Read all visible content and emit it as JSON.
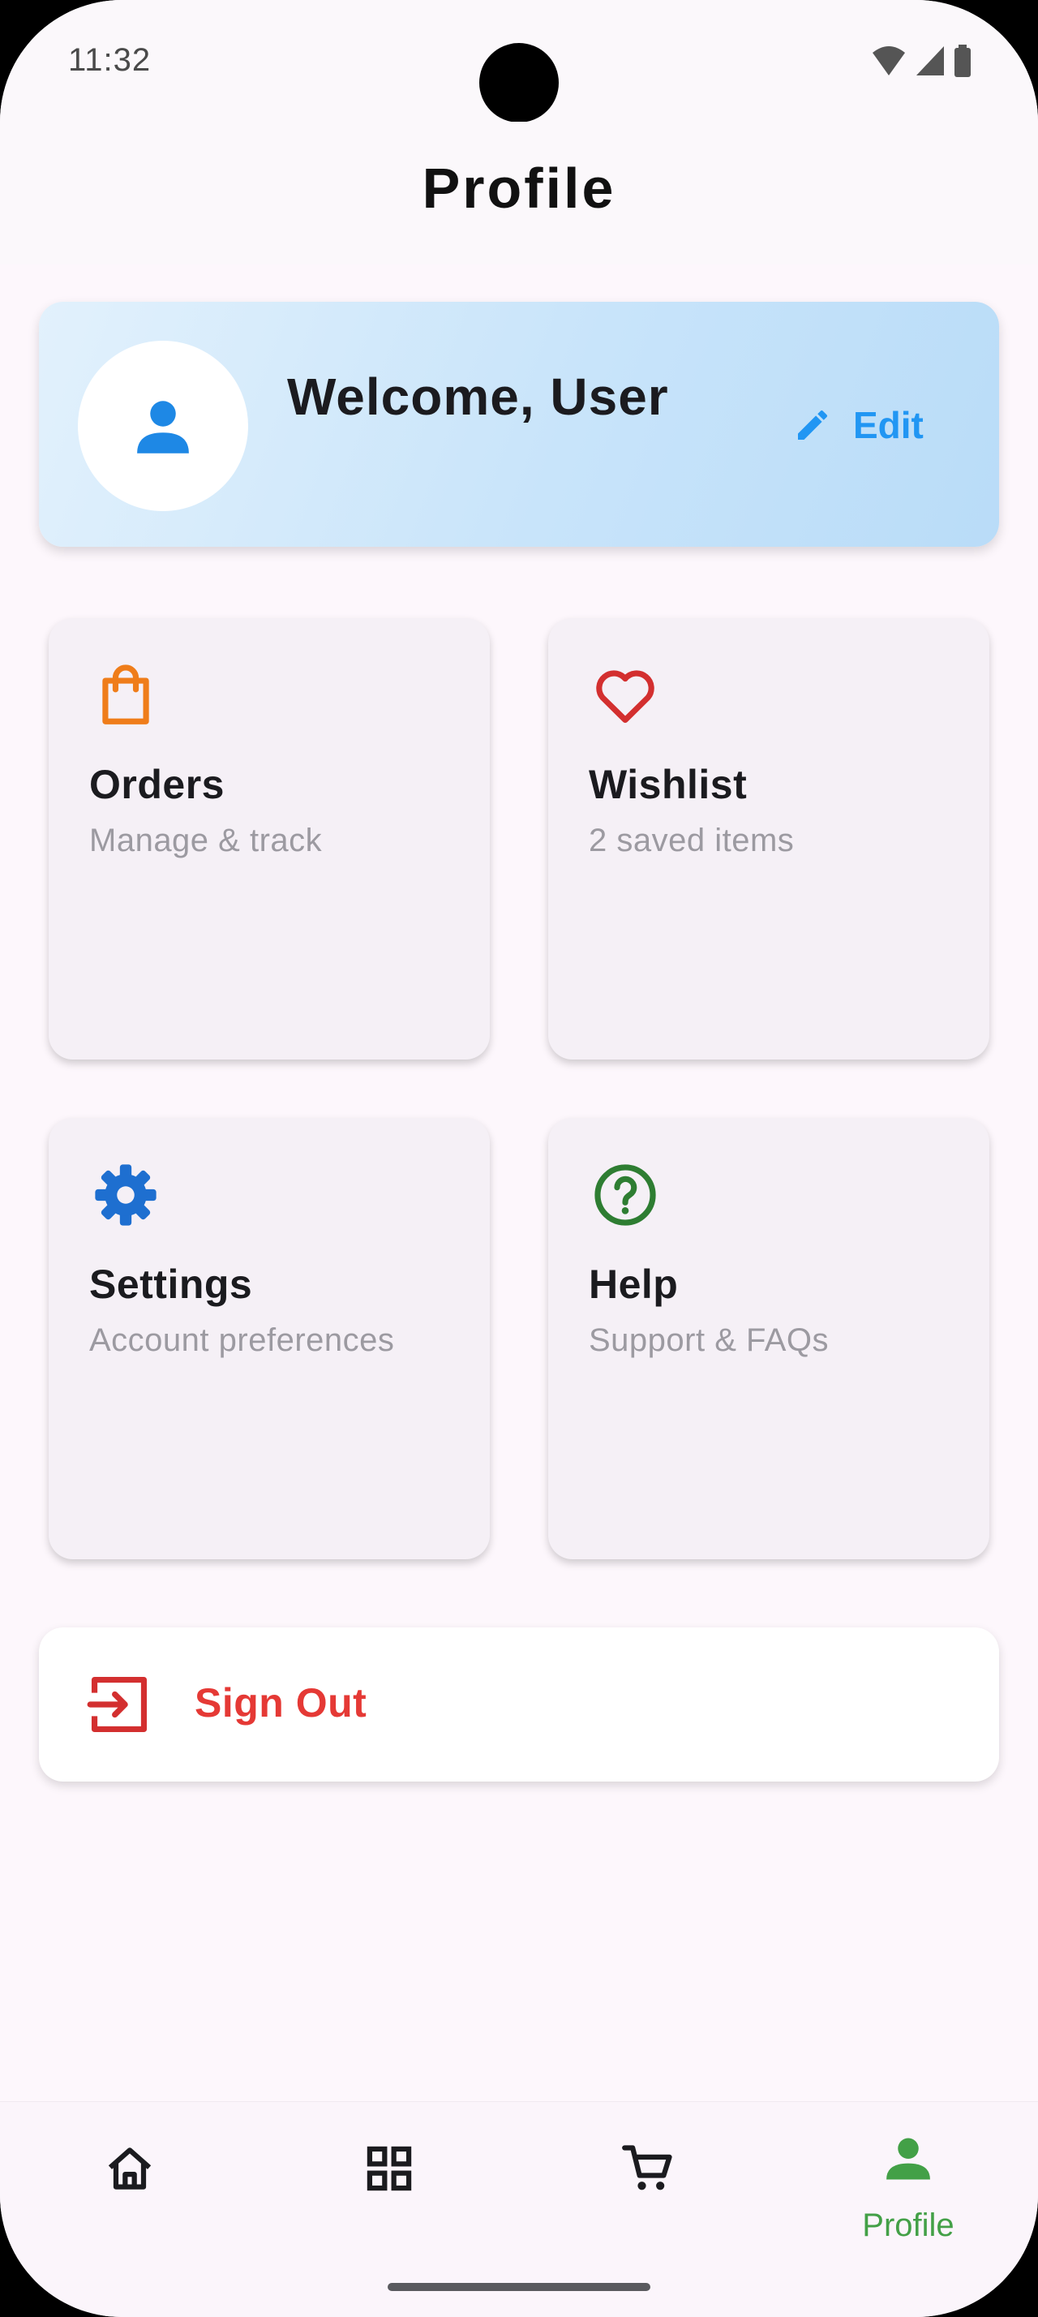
{
  "status": {
    "time": "11:32"
  },
  "appbar": {
    "title": "Profile"
  },
  "welcome": {
    "text": "Welcome, User",
    "edit_label": "Edit"
  },
  "tiles": [
    {
      "title": "Orders",
      "subtitle": "Manage & track",
      "icon": "shopping-bag-icon",
      "color": "#ef7d1a"
    },
    {
      "title": "Wishlist",
      "subtitle": "2 saved items",
      "icon": "heart-icon",
      "color": "#d32f2f"
    },
    {
      "title": "Settings",
      "subtitle": "Account preferences",
      "icon": "gear-icon",
      "color": "#1e6fd0"
    },
    {
      "title": "Help",
      "subtitle": "Support & FAQs",
      "icon": "help-circle-icon",
      "color": "#2e7d32"
    }
  ],
  "signout": {
    "label": "Sign Out",
    "icon": "logout-icon",
    "color": "#d32f2f"
  },
  "nav": {
    "items": [
      {
        "icon": "home-icon"
      },
      {
        "icon": "grid-icon"
      },
      {
        "icon": "cart-icon"
      },
      {
        "icon": "person-icon",
        "label": "Profile",
        "active": true
      }
    ]
  },
  "colors": {
    "accent": "#2196f3",
    "nav_active": "#43a047",
    "danger": "#e53935"
  }
}
